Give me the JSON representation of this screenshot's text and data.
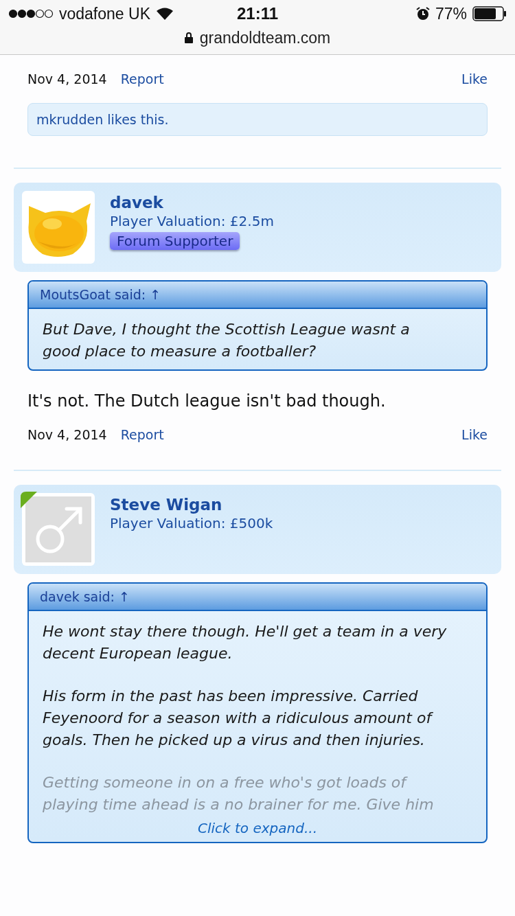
{
  "status_bar": {
    "carrier": "vodafone UK",
    "time": "21:11",
    "battery": "77%",
    "url": "grandoldteam.com"
  },
  "posts": [
    {
      "date": "Nov 4, 2014",
      "report": "Report",
      "like": "Like",
      "likes": "mkrudden likes this."
    },
    {
      "user": {
        "name": "davek",
        "valuation": "Player Valuation: £2.5m",
        "badge": "Forum Supporter",
        "online": false
      },
      "quote": {
        "author": "MoutsGoat said: ↑",
        "paragraphs": [
          {
            "text": "But Dave, I thought the Scottish League wasnt a good place to measure a footballer?",
            "faded": false
          }
        ]
      },
      "message": "It's not. The Dutch league isn't bad though.",
      "date": "Nov 4, 2014",
      "report": "Report",
      "like": "Like"
    },
    {
      "user": {
        "name": "Steve Wigan",
        "valuation": "Player Valuation: £500k",
        "avatar": {
          "kind": "default"
        },
        "online": true
      },
      "quote": {
        "author": "davek said: ↑",
        "paragraphs": [
          {
            "text": "He wont stay there though. He'll get a team in a very decent European league.",
            "faded": false
          },
          {
            "text": "His form in the past has been impressive. Carried Feyenoord for a season with a ridiculous amount of goals. Then he picked up a virus and then injuries.",
            "faded": false
          },
          {
            "text": "Getting someone in on a free who's got loads of playing time ahead is a no brainer for me. Give him",
            "faded": true
          }
        ],
        "expand": "Click to expand..."
      }
    }
  ]
}
